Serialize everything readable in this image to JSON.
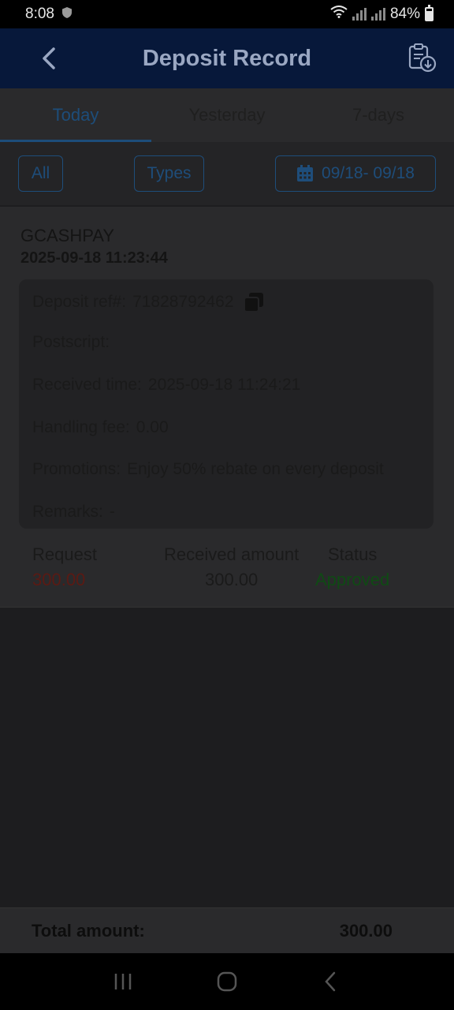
{
  "status_bar": {
    "time": "8:08",
    "battery": "84%"
  },
  "header": {
    "title": "Deposit Record"
  },
  "tabs": [
    {
      "label": "Today",
      "active": true
    },
    {
      "label": "Yesterday",
      "active": false
    },
    {
      "label": "7-days",
      "active": false
    }
  ],
  "filters": {
    "all_label": "All",
    "types_label": "Types",
    "date_range": "09/18- 09/18"
  },
  "record": {
    "method": "GCASHPAY",
    "datetime": "2025-09-18 11:23:44",
    "details": {
      "deposit_ref_label": "Deposit ref#:",
      "deposit_ref_value": "71828792462",
      "postscript_label": "Postscript:",
      "received_time_label": "Received time:",
      "received_time_value": "2025-09-18 11:24:21",
      "handling_fee_label": "Handling fee:",
      "handling_fee_value": "0.00",
      "promotions_label": "Promotions:",
      "promotions_value": "Enjoy 50% rebate on every deposit",
      "remarks_label": "Remarks:",
      "remarks_value": "-"
    },
    "request_label": "Request",
    "request_value": "300.00",
    "received_label": "Received amount",
    "received_value": "300.00",
    "status_label": "Status",
    "status_value": "Approved"
  },
  "total": {
    "label": "Total amount:",
    "value": "300.00"
  },
  "colors": {
    "request": "#5a1a14",
    "approved": "#0f4a14",
    "accent": "#1d4d7a",
    "header_bg": "#07183a"
  }
}
